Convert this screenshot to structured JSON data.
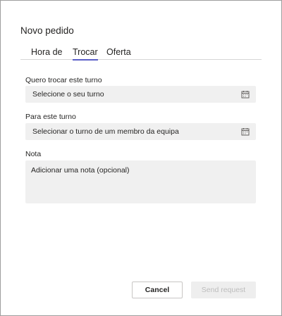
{
  "dialog": {
    "title": "Novo pedido",
    "tabs": [
      {
        "label": "Hora de"
      },
      {
        "label": "Trocar"
      },
      {
        "label": "Oferta"
      }
    ],
    "active_tab": "Trocar",
    "fields": {
      "my_shift": {
        "label": "Quero trocar este turno",
        "value": "Selecione o seu turno",
        "icon": "calendar-icon"
      },
      "their_shift": {
        "label": "Para este turno",
        "value": "Selecionar o turno de um membro da equipa",
        "icon": "calendar-icon"
      },
      "note": {
        "label": "Nota",
        "placeholder": "Adicionar uma nota (opcional)"
      }
    },
    "buttons": {
      "cancel": "Cancel",
      "send": "Send request"
    },
    "colors": {
      "accent": "#5b5fc7",
      "field_bg": "#f0f0f0",
      "disabled_text": "#bdbdbd"
    }
  }
}
